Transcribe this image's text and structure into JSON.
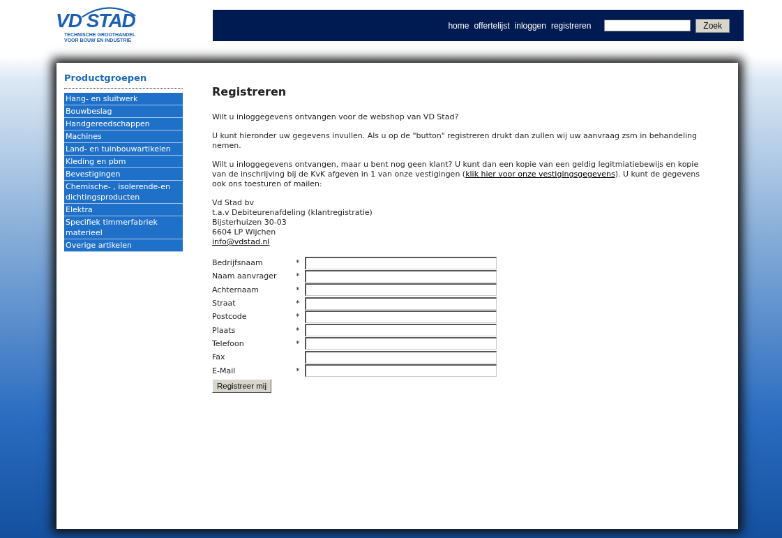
{
  "logo": {
    "name": "VD STAD",
    "tagline": [
      "TECHNISCHE GROOTHANDEL",
      "VOOR BOUW EN INDUSTRIE"
    ]
  },
  "nav": {
    "links": [
      "home",
      "offertelijst",
      "inloggen",
      "registreren"
    ],
    "search_button": "Zoek"
  },
  "sidebar": {
    "title": "Productgroepen",
    "items": [
      "Hang- en sluitwerk",
      "Bouwbeslag",
      "Handgereedschappen",
      "Machines",
      "Land- en tuinbouwartikelen",
      "Kleding en pbm",
      "Bevestigingen",
      "Chemische- , isolerende-en dichtingsproducten",
      "Elektra",
      "Specifiek timmerfabriek materieel",
      "Overige artikelen"
    ]
  },
  "content": {
    "title": "Registreren",
    "paragraphs": [
      [
        {
          "text": "Wilt u inloggegevens ontvangen voor de webshop van VD Stad?"
        }
      ],
      [
        {
          "text": "U kunt hieronder uw gegevens invullen. Als u op de \"button\" registreren drukt dan zullen wij uw aanvraag zsm in behandeling nemen."
        }
      ],
      [
        {
          "text": "Wilt u inloggegevens ontvangen, maar u bent nog geen klant? U kunt dan een kopie van een geldig legitmiatiebewijs en kopie van de inschrijving bij de KvK afgeven in 1 van onze vestigingen ("
        },
        {
          "text": "klik hier voor onze vestigingsgegevens",
          "link": true
        },
        {
          "text": "). U kunt de gegevens ook ons toesturen of mailen:"
        }
      ]
    ],
    "address": [
      "Vd Stad bv",
      "t.a.v Debiteurenafdeling (klantregistratie)",
      "Bijsterhuizen 30-03",
      "6604 LP Wijchen"
    ],
    "email": "info@vdstad.nl",
    "fields": [
      {
        "label": "Bedrijfsnaam",
        "marker": "*"
      },
      {
        "label": "Naam aanvrager",
        "marker": "*"
      },
      {
        "label": "Achternaam",
        "marker": "*"
      },
      {
        "label": "Straat",
        "marker": "*"
      },
      {
        "label": "Postcode",
        "marker": "*"
      },
      {
        "label": "Plaats",
        "marker": "*"
      },
      {
        "label": "Telefoon",
        "marker": "*"
      },
      {
        "label": "Fax"
      },
      {
        "label": "E-Mail",
        "marker": "*"
      }
    ],
    "submit": "Registreer mij"
  }
}
